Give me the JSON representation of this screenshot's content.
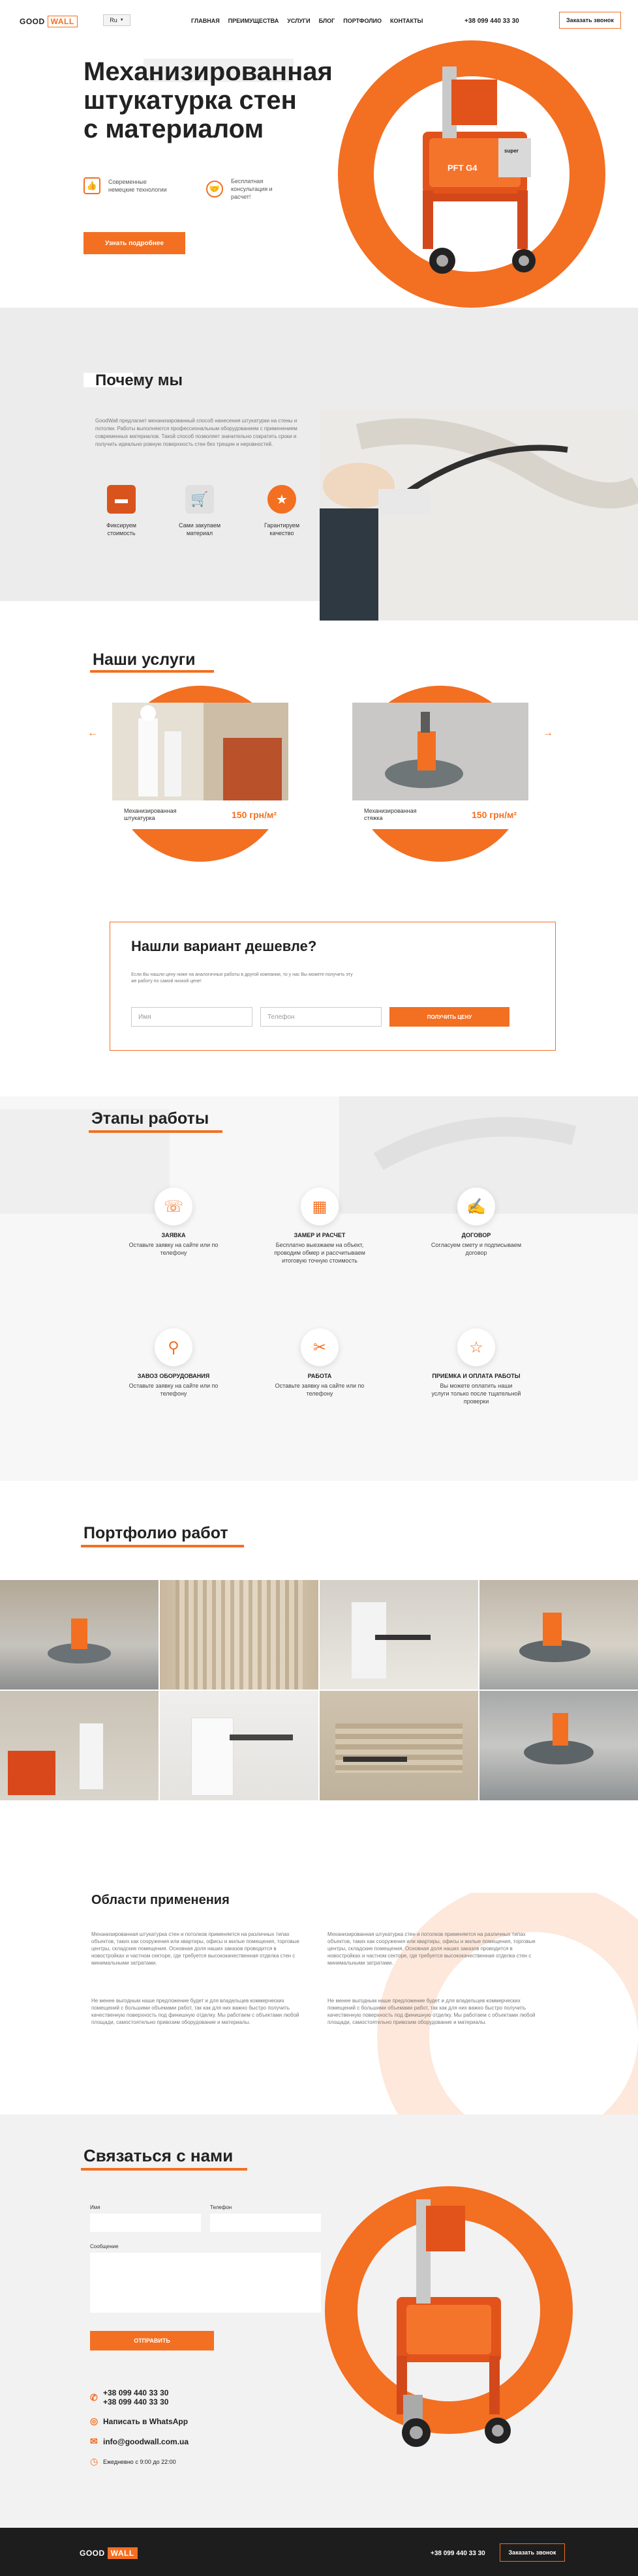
{
  "header": {
    "logo_good": "GOOD",
    "logo_wall": "WALL",
    "lang": "Ru",
    "nav": [
      "ГЛАВНАЯ",
      "ПРЕИМУЩЕСТВА",
      "УСЛУГИ",
      "БЛОГ",
      "ПОРТФОЛИО",
      "КОНТАКТЫ"
    ],
    "phone": "+38 099 440 33 30",
    "order_call": "Заказать звонок"
  },
  "hero": {
    "title_line1": "Механизированная",
    "title_line2": "штукатурка стен",
    "title_line3": "с материалом",
    "feature1": "Современные немецкие технологии",
    "feature2": "Бесплатная консультация и расчет!",
    "cta": "Узнать подробнее"
  },
  "why": {
    "title": "Почему мы",
    "text": "GoodWall предлагает механизированный способ нанесения штукатурки на стены и потолки. Работы выполняются профессиональным оборудованием с применением современных материалов. Такой способ позволяет значительно сократить сроки и получить идеально ровную поверхность стен без трещин и неровностей.",
    "items": [
      "Фиксируем стоимость",
      "Сами закупаем материал",
      "Гарантируем качество"
    ]
  },
  "services": {
    "title": "Наши услуги",
    "items": [
      {
        "name": "Механизированная штукатурка",
        "price": "150 грн/м²"
      },
      {
        "name": "Механизированная стяжка",
        "price": "150 грн/м²"
      }
    ]
  },
  "cheaper": {
    "title": "Нашли вариант дешевле?",
    "text": "Если Вы нашли цену ниже на аналогичные работы в другой компании, то у нас Вы можете получить эту же работу по самой низкой цене!",
    "name_placeholder": "Имя",
    "phone_placeholder": "Телефон",
    "button": "ПОЛУЧИТЬ ЦЕНУ"
  },
  "stages": {
    "title": "Этапы работы",
    "items": [
      {
        "title": "ЗАЯВКА",
        "text": "Оставьте заявку на сайте или по телефону"
      },
      {
        "title": "ЗАМЕР И РАСЧЕТ",
        "text": "Бесплатно выезжаем на объект, проводим обмер и рассчитываем итоговую точную стоимость"
      },
      {
        "title": "ДОГОВОР",
        "text": "Согласуем смету и подписываем договор"
      },
      {
        "title": "ЗАВОЗ ОБОРУДОВАНИЯ",
        "text": "Оставьте заявку на сайте или по телефону"
      },
      {
        "title": "РАБОТА",
        "text": "Оставьте заявку на сайте или по телефону"
      },
      {
        "title": "ПРИЕМКА И ОПЛАТА РАБОТЫ",
        "text": "Вы можете оплатить наши услуги только после тщательной проверки"
      }
    ]
  },
  "portfolio": {
    "title": "Портфолио работ"
  },
  "areas": {
    "title": "Области применения",
    "col1_p1": "Механизированная штукатурка стен и потолков применяется на различных типах объектов, таких как сооружения или квартиры, офисы и жилые помещения, торговые центры, складские помещения. Основная доля наших заказов проводится в новостройках и частном секторе, где требуется высококачественная отделка стен с минимальными затратами.",
    "col1_p2": "Не менее выгодным наше предложение будет и для владельцев коммерческих помещений с большими объемами работ, так как для них важно быстро получить качественную поверхность под финишную отделку. Мы работаем с объектами любой площади, самостоятельно привозим оборудование и материалы.",
    "col2_p1": "Механизированная штукатурка стен и потолков применяется на различных типах объектов, таких как сооружения или квартиры, офисы и жилые помещения, торговые центры, складские помещения. Основная доля наших заказов проводится в новостройках и частном секторе, где требуется высококачественная отделка стен с минимальными затратами.",
    "col2_p2": "Не менее выгодным наше предложение будет и для владельцев коммерческих помещений с большими объемами работ, так как для них важно быстро получить качественную поверхность под финишную отделку. Мы работаем с объектами любой площади, самостоятельно привозим оборудование и материалы."
  },
  "contact": {
    "title": "Связаться с нами",
    "name_label": "Имя",
    "phone_label": "Телефон",
    "message_label": "Сообщение",
    "button": "ОТПРАВИТЬ",
    "phone1": "+38 099 440 33 30",
    "phone2": "+38 099 440 33 30",
    "whatsapp": "Написать в WhatsApp",
    "email": "info@goodwall.com.ua",
    "hours": "Ежедневно с 9:00 до 22:00"
  },
  "footer": {
    "logo_good": "GOOD",
    "logo_wall": "WALL",
    "phone": "+38 099 440 33 30",
    "order_call": "Заказать звонок"
  },
  "colors": {
    "accent": "#f36f21",
    "dark": "#1d1d1d",
    "light_gray": "#f2f2f2"
  }
}
